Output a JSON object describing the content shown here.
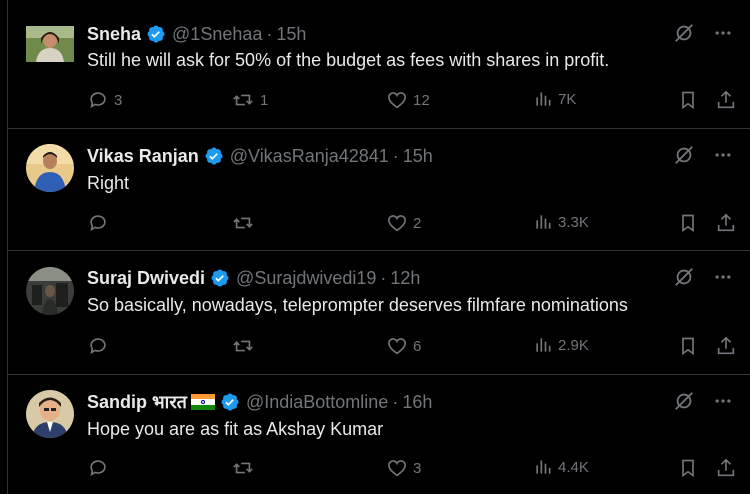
{
  "tweets": [
    {
      "name": "Sneha",
      "handle": "@1Snehaa",
      "time": "15h",
      "text": "Still he will ask for 50% of the budget as fees with shares in profit.",
      "replies": "3",
      "reposts": "1",
      "likes": "12",
      "views": "7K",
      "avatar_icon": "avatar-woman-photo"
    },
    {
      "name": "Vikas Ranjan",
      "handle": "@VikasRanja42841",
      "time": "15h",
      "text": "Right",
      "replies": "",
      "reposts": "",
      "likes": "2",
      "views": "3.3K",
      "avatar_icon": "avatar-man-blue-shirt"
    },
    {
      "name": "Suraj Dwivedi",
      "handle": "@Surajdwivedi19",
      "time": "12h",
      "text": "So basically, nowadays, teleprompter deserves filmfare nominations",
      "replies": "",
      "reposts": "",
      "likes": "6",
      "views": "2.9K",
      "avatar_icon": "avatar-gym-photo"
    },
    {
      "name": "Sandip भारत",
      "handle": "@IndiaBottomline",
      "time": "16h",
      "text": "Hope you are as fit as Akshay Kumar",
      "replies": "",
      "reposts": "",
      "likes": "3",
      "views": "4.4K",
      "avatar_icon": "avatar-cartoon-man",
      "name_flag_icon": "india-flag-icon"
    }
  ],
  "colors": {
    "background": "#000000",
    "text": "#e7e9ea",
    "muted": "#71767b",
    "verified": "#1d9bf0",
    "divider": "#2f3336"
  }
}
